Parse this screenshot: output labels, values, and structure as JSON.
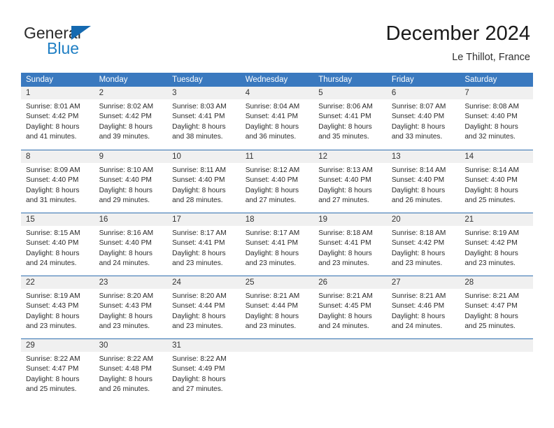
{
  "brand": {
    "name_part1": "General",
    "name_part2": "Blue",
    "flag_icon": "blue-triangle-flag-icon"
  },
  "header": {
    "title": "December 2024",
    "subtitle": "Le Thillot, France"
  },
  "colors": {
    "header_blue": "#3a79bf",
    "row_divider_blue": "#2f6fb0",
    "daynum_band": "#f0f0f0",
    "brand_blue": "#1f7fc4",
    "text": "#2a2a2a"
  },
  "weekday_headers": [
    "Sunday",
    "Monday",
    "Tuesday",
    "Wednesday",
    "Thursday",
    "Friday",
    "Saturday"
  ],
  "weeks": [
    [
      {
        "day": "1",
        "lines": [
          "Sunrise: 8:01 AM",
          "Sunset: 4:42 PM",
          "Daylight: 8 hours",
          "and 41 minutes."
        ]
      },
      {
        "day": "2",
        "lines": [
          "Sunrise: 8:02 AM",
          "Sunset: 4:42 PM",
          "Daylight: 8 hours",
          "and 39 minutes."
        ]
      },
      {
        "day": "3",
        "lines": [
          "Sunrise: 8:03 AM",
          "Sunset: 4:41 PM",
          "Daylight: 8 hours",
          "and 38 minutes."
        ]
      },
      {
        "day": "4",
        "lines": [
          "Sunrise: 8:04 AM",
          "Sunset: 4:41 PM",
          "Daylight: 8 hours",
          "and 36 minutes."
        ]
      },
      {
        "day": "5",
        "lines": [
          "Sunrise: 8:06 AM",
          "Sunset: 4:41 PM",
          "Daylight: 8 hours",
          "and 35 minutes."
        ]
      },
      {
        "day": "6",
        "lines": [
          "Sunrise: 8:07 AM",
          "Sunset: 4:40 PM",
          "Daylight: 8 hours",
          "and 33 minutes."
        ]
      },
      {
        "day": "7",
        "lines": [
          "Sunrise: 8:08 AM",
          "Sunset: 4:40 PM",
          "Daylight: 8 hours",
          "and 32 minutes."
        ]
      }
    ],
    [
      {
        "day": "8",
        "lines": [
          "Sunrise: 8:09 AM",
          "Sunset: 4:40 PM",
          "Daylight: 8 hours",
          "and 31 minutes."
        ]
      },
      {
        "day": "9",
        "lines": [
          "Sunrise: 8:10 AM",
          "Sunset: 4:40 PM",
          "Daylight: 8 hours",
          "and 29 minutes."
        ]
      },
      {
        "day": "10",
        "lines": [
          "Sunrise: 8:11 AM",
          "Sunset: 4:40 PM",
          "Daylight: 8 hours",
          "and 28 minutes."
        ]
      },
      {
        "day": "11",
        "lines": [
          "Sunrise: 8:12 AM",
          "Sunset: 4:40 PM",
          "Daylight: 8 hours",
          "and 27 minutes."
        ]
      },
      {
        "day": "12",
        "lines": [
          "Sunrise: 8:13 AM",
          "Sunset: 4:40 PM",
          "Daylight: 8 hours",
          "and 27 minutes."
        ]
      },
      {
        "day": "13",
        "lines": [
          "Sunrise: 8:14 AM",
          "Sunset: 4:40 PM",
          "Daylight: 8 hours",
          "and 26 minutes."
        ]
      },
      {
        "day": "14",
        "lines": [
          "Sunrise: 8:14 AM",
          "Sunset: 4:40 PM",
          "Daylight: 8 hours",
          "and 25 minutes."
        ]
      }
    ],
    [
      {
        "day": "15",
        "lines": [
          "Sunrise: 8:15 AM",
          "Sunset: 4:40 PM",
          "Daylight: 8 hours",
          "and 24 minutes."
        ]
      },
      {
        "day": "16",
        "lines": [
          "Sunrise: 8:16 AM",
          "Sunset: 4:40 PM",
          "Daylight: 8 hours",
          "and 24 minutes."
        ]
      },
      {
        "day": "17",
        "lines": [
          "Sunrise: 8:17 AM",
          "Sunset: 4:41 PM",
          "Daylight: 8 hours",
          "and 23 minutes."
        ]
      },
      {
        "day": "18",
        "lines": [
          "Sunrise: 8:17 AM",
          "Sunset: 4:41 PM",
          "Daylight: 8 hours",
          "and 23 minutes."
        ]
      },
      {
        "day": "19",
        "lines": [
          "Sunrise: 8:18 AM",
          "Sunset: 4:41 PM",
          "Daylight: 8 hours",
          "and 23 minutes."
        ]
      },
      {
        "day": "20",
        "lines": [
          "Sunrise: 8:18 AM",
          "Sunset: 4:42 PM",
          "Daylight: 8 hours",
          "and 23 minutes."
        ]
      },
      {
        "day": "21",
        "lines": [
          "Sunrise: 8:19 AM",
          "Sunset: 4:42 PM",
          "Daylight: 8 hours",
          "and 23 minutes."
        ]
      }
    ],
    [
      {
        "day": "22",
        "lines": [
          "Sunrise: 8:19 AM",
          "Sunset: 4:43 PM",
          "Daylight: 8 hours",
          "and 23 minutes."
        ]
      },
      {
        "day": "23",
        "lines": [
          "Sunrise: 8:20 AM",
          "Sunset: 4:43 PM",
          "Daylight: 8 hours",
          "and 23 minutes."
        ]
      },
      {
        "day": "24",
        "lines": [
          "Sunrise: 8:20 AM",
          "Sunset: 4:44 PM",
          "Daylight: 8 hours",
          "and 23 minutes."
        ]
      },
      {
        "day": "25",
        "lines": [
          "Sunrise: 8:21 AM",
          "Sunset: 4:44 PM",
          "Daylight: 8 hours",
          "and 23 minutes."
        ]
      },
      {
        "day": "26",
        "lines": [
          "Sunrise: 8:21 AM",
          "Sunset: 4:45 PM",
          "Daylight: 8 hours",
          "and 24 minutes."
        ]
      },
      {
        "day": "27",
        "lines": [
          "Sunrise: 8:21 AM",
          "Sunset: 4:46 PM",
          "Daylight: 8 hours",
          "and 24 minutes."
        ]
      },
      {
        "day": "28",
        "lines": [
          "Sunrise: 8:21 AM",
          "Sunset: 4:47 PM",
          "Daylight: 8 hours",
          "and 25 minutes."
        ]
      }
    ],
    [
      {
        "day": "29",
        "lines": [
          "Sunrise: 8:22 AM",
          "Sunset: 4:47 PM",
          "Daylight: 8 hours",
          "and 25 minutes."
        ]
      },
      {
        "day": "30",
        "lines": [
          "Sunrise: 8:22 AM",
          "Sunset: 4:48 PM",
          "Daylight: 8 hours",
          "and 26 minutes."
        ]
      },
      {
        "day": "31",
        "lines": [
          "Sunrise: 8:22 AM",
          "Sunset: 4:49 PM",
          "Daylight: 8 hours",
          "and 27 minutes."
        ]
      },
      {
        "day": "",
        "lines": []
      },
      {
        "day": "",
        "lines": []
      },
      {
        "day": "",
        "lines": []
      },
      {
        "day": "",
        "lines": []
      }
    ]
  ]
}
